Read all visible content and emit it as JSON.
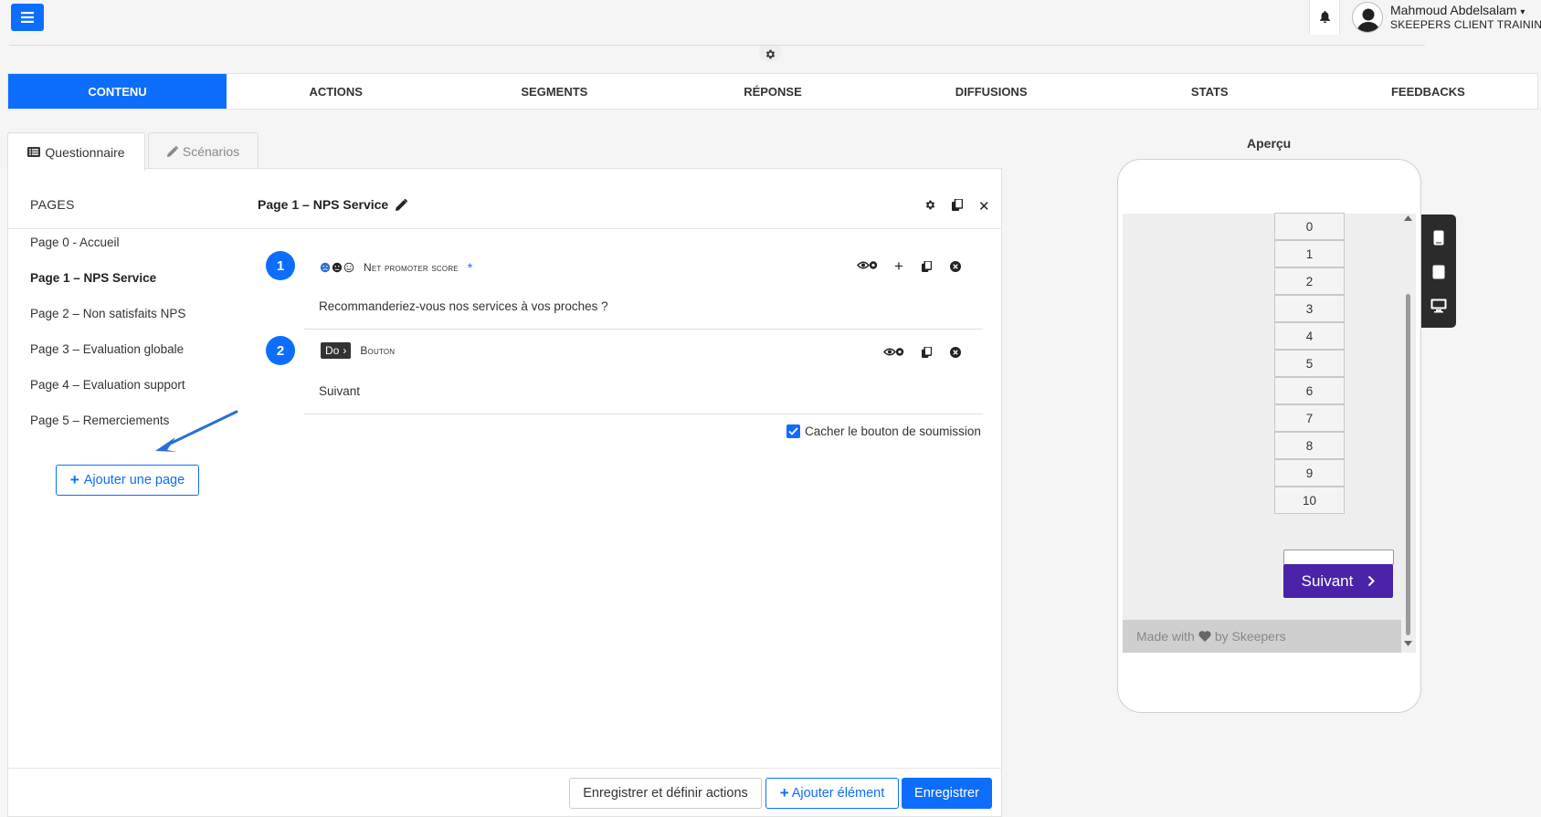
{
  "header": {
    "user_name": "Mahmoud Abdelsalam",
    "user_org": "SKEEPERS CLIENT TRAINING"
  },
  "main_tabs": [
    {
      "label": "CONTENU",
      "active": true
    },
    {
      "label": "ACTIONS"
    },
    {
      "label": "SEGMENTS"
    },
    {
      "label": "RÉPONSE"
    },
    {
      "label": "DIFFUSIONS"
    },
    {
      "label": "STATS"
    },
    {
      "label": "FEEDBACKS"
    }
  ],
  "sub_tabs": {
    "questionnaire": "Questionnaire",
    "scenarios": "Scénarios"
  },
  "pages": {
    "title": "PAGES",
    "items": [
      "Page 0 - Accueil",
      "Page 1 – NPS Service",
      "Page 2 – Non satisfaits NPS",
      "Page 3 – Evaluation globale",
      "Page 4 – Evaluation support",
      "Page 5 – Remerciements"
    ],
    "active_index": 1,
    "add_label": "Ajouter une page"
  },
  "editor": {
    "page_title": "Page 1 – NPS Service",
    "questions": [
      {
        "number": "1",
        "type": "Net promoter score",
        "required_mark": "*",
        "text": "Recommanderiez-vous nos services à vos proches ?"
      },
      {
        "number": "2",
        "badge": "Do",
        "type": "Bouton",
        "text": "Suivant"
      }
    ],
    "hide_submit_label": "Cacher le bouton de soumission",
    "hide_submit_checked": true
  },
  "footer": {
    "save_actions": "Enregistrer et définir actions",
    "add_element": "Ajouter élément",
    "save": "Enregistrer"
  },
  "preview": {
    "title": "Aperçu",
    "nps_values": [
      "0",
      "1",
      "2",
      "3",
      "4",
      "5",
      "6",
      "7",
      "8",
      "9",
      "10"
    ],
    "next_label": "Suivant",
    "made_with": "Made with",
    "by_brand": "by Skeepers"
  },
  "colors": {
    "primary": "#0d6efd",
    "preview_button": "#4b23a8",
    "device_bar": "#2b2b2b"
  }
}
